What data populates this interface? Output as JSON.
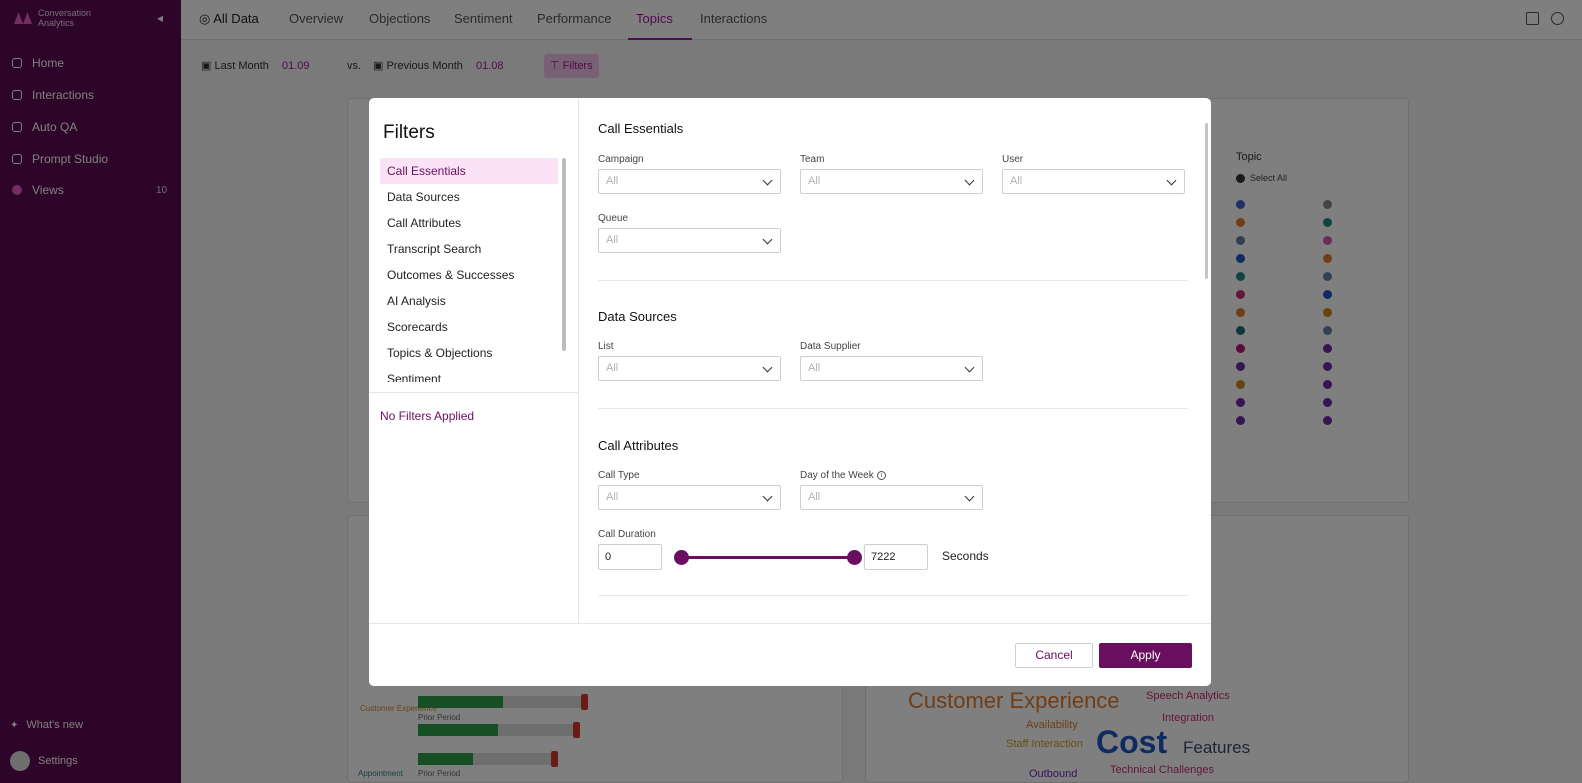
{
  "sidebar": {
    "brand": "Conversation Analytics",
    "items": [
      {
        "label": "Home",
        "icon": "home-icon"
      },
      {
        "label": "Interactions",
        "icon": "interactions-icon"
      },
      {
        "label": "Auto QA",
        "icon": "check-icon"
      },
      {
        "label": "Prompt Studio",
        "icon": "studio-icon"
      },
      {
        "label": "Views",
        "icon": "views-icon",
        "badge": "10"
      }
    ],
    "whats_new": "What's new",
    "settings": "Settings"
  },
  "topbar": {
    "data_scope": "All Data",
    "tabs": [
      "Overview",
      "Objections",
      "Sentiment",
      "Performance",
      "Topics",
      "Interactions"
    ],
    "active_tab": "Topics"
  },
  "filterbar": {
    "period": "Last Month",
    "period_dates": "01.09",
    "vs": "vs.",
    "compare": "Previous Month",
    "compare_dates": "01.08",
    "filters": "Filters"
  },
  "background": {
    "legend_title": "Topic",
    "legend_select_all": "Select All",
    "wordcloud": [
      "Customer Experience",
      "Cost",
      "Features",
      "Availability",
      "Staff Interaction",
      "Integration",
      "Outbound",
      "Technical Challenges",
      "Speech Analytics"
    ],
    "bar_labels": [
      "Prior Period",
      "Prior Period"
    ],
    "side_labels": [
      "Customer Experience",
      "Appointment"
    ],
    "colors": {
      "green": "#2f9e4a",
      "red": "#d03a2c"
    }
  },
  "modal": {
    "title": "Filters",
    "nav": [
      "Call Essentials",
      "Data Sources",
      "Call Attributes",
      "Transcript Search",
      "Outcomes & Successes",
      "AI Analysis",
      "Scorecards",
      "Topics & Objections",
      "Sentiment"
    ],
    "active_nav": "Call Essentials",
    "no_filters": "No Filters Applied",
    "sections": {
      "call_essentials": {
        "title": "Call Essentials",
        "campaign": {
          "label": "Campaign",
          "value": "All"
        },
        "team": {
          "label": "Team",
          "value": "All"
        },
        "user": {
          "label": "User",
          "value": "All"
        },
        "queue": {
          "label": "Queue",
          "value": "All"
        }
      },
      "data_sources": {
        "title": "Data Sources",
        "list": {
          "label": "List",
          "value": "All"
        },
        "data_supplier": {
          "label": "Data Supplier",
          "value": "All"
        }
      },
      "call_attributes": {
        "title": "Call Attributes",
        "call_type": {
          "label": "Call Type",
          "value": "All"
        },
        "day_of_week": {
          "label": "Day of the Week",
          "value": "All"
        },
        "call_duration": {
          "label": "Call Duration",
          "min": "0",
          "max": "7222",
          "unit": "Seconds"
        }
      }
    },
    "cancel": "Cancel",
    "apply": "Apply"
  },
  "colors": {
    "brand": "#6a0f5f",
    "sidebar": "#5a0a52",
    "active_nav_bg": "#fbe3f7",
    "accent": "#a4179a"
  }
}
